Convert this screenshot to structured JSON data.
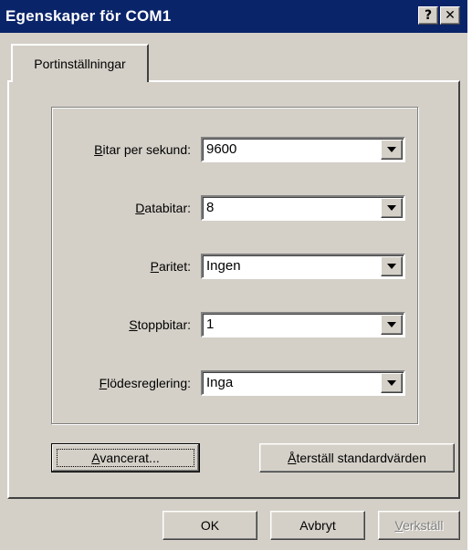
{
  "window": {
    "title": "Egenskaper för COM1",
    "help_glyph": "?",
    "close_glyph": "✕"
  },
  "tabs": [
    {
      "label": "Portinställningar",
      "selected": true
    }
  ],
  "settings": [
    {
      "label_accel": "B",
      "label_rest": "itar per sekund:",
      "value": "9600"
    },
    {
      "label_accel": "D",
      "label_rest": "atabitar:",
      "value": "8"
    },
    {
      "label_accel": "P",
      "label_rest": "aritet:",
      "value": "Ingen"
    },
    {
      "label_accel": "S",
      "label_rest": "toppbitar:",
      "value": "1"
    },
    {
      "label_accel": "F",
      "label_rest": "lödesreglering:",
      "value": "Inga"
    }
  ],
  "buttons": {
    "advanced": {
      "accel": "A",
      "rest": "vancerat..."
    },
    "restore": {
      "accel": "Å",
      "rest": "terställ standardvärden"
    },
    "ok": "OK",
    "cancel": "Avbryt",
    "apply": {
      "accel": "V",
      "rest": "erkställ",
      "enabled": false
    }
  },
  "colors": {
    "titlebar": "#0a246a",
    "face": "#d4d0c8"
  }
}
